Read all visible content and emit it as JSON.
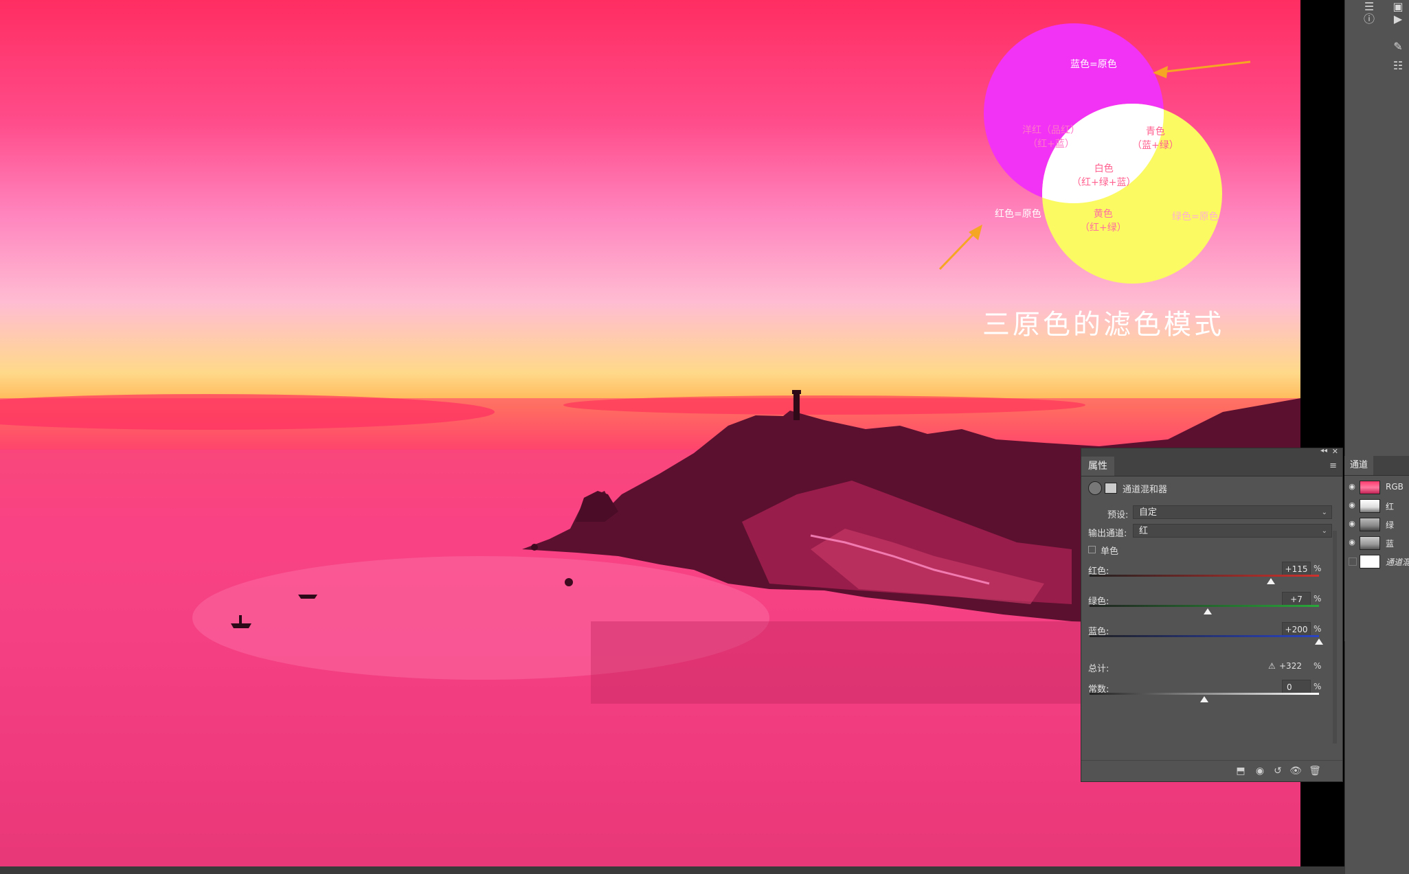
{
  "venn": {
    "title": "三原色的滤色模式",
    "blue_label": "蓝色=原色",
    "red_label": "红色=原色",
    "green_label": "绿色=原色",
    "magenta_label": "洋红（品红）",
    "magenta_sub": "（红+蓝）",
    "cyan_label": "青色",
    "cyan_sub": "（蓝+绿）",
    "white_label": "白色",
    "white_sub": "（红+绿+蓝）",
    "yellow_label": "黄色",
    "yellow_sub": "（红+绿）",
    "colors": {
      "magenta": "#f232f5",
      "yellow": "#fbfa63",
      "white": "#ffffff",
      "arrow": "#f5a623"
    }
  },
  "properties": {
    "tab": "属性",
    "adjustment_name": "通道混和器",
    "preset_label": "预设:",
    "preset_value": "自定",
    "output_label": "输出通道:",
    "output_value": "红",
    "mono_label": "单色",
    "pct": "%",
    "sliders": [
      {
        "label": "红色:",
        "value": "+115",
        "fraction": 0.79,
        "color": "#d0312d"
      },
      {
        "label": "绿色:",
        "value": "+7",
        "fraction": 0.515,
        "color": "#28a83a"
      },
      {
        "label": "蓝色:",
        "value": "+200",
        "fraction": 1.0,
        "color": "#2a44c4"
      }
    ],
    "total_label": "总计:",
    "total_value": "+322",
    "constant_label": "常数:",
    "constant_value": "0",
    "constant_fraction": 0.5
  },
  "channels": {
    "tab": "通道",
    "items": [
      {
        "name": "RGB"
      },
      {
        "name": "红"
      },
      {
        "name": "绿"
      },
      {
        "name": "蓝"
      },
      {
        "name": "通道混..."
      }
    ]
  }
}
